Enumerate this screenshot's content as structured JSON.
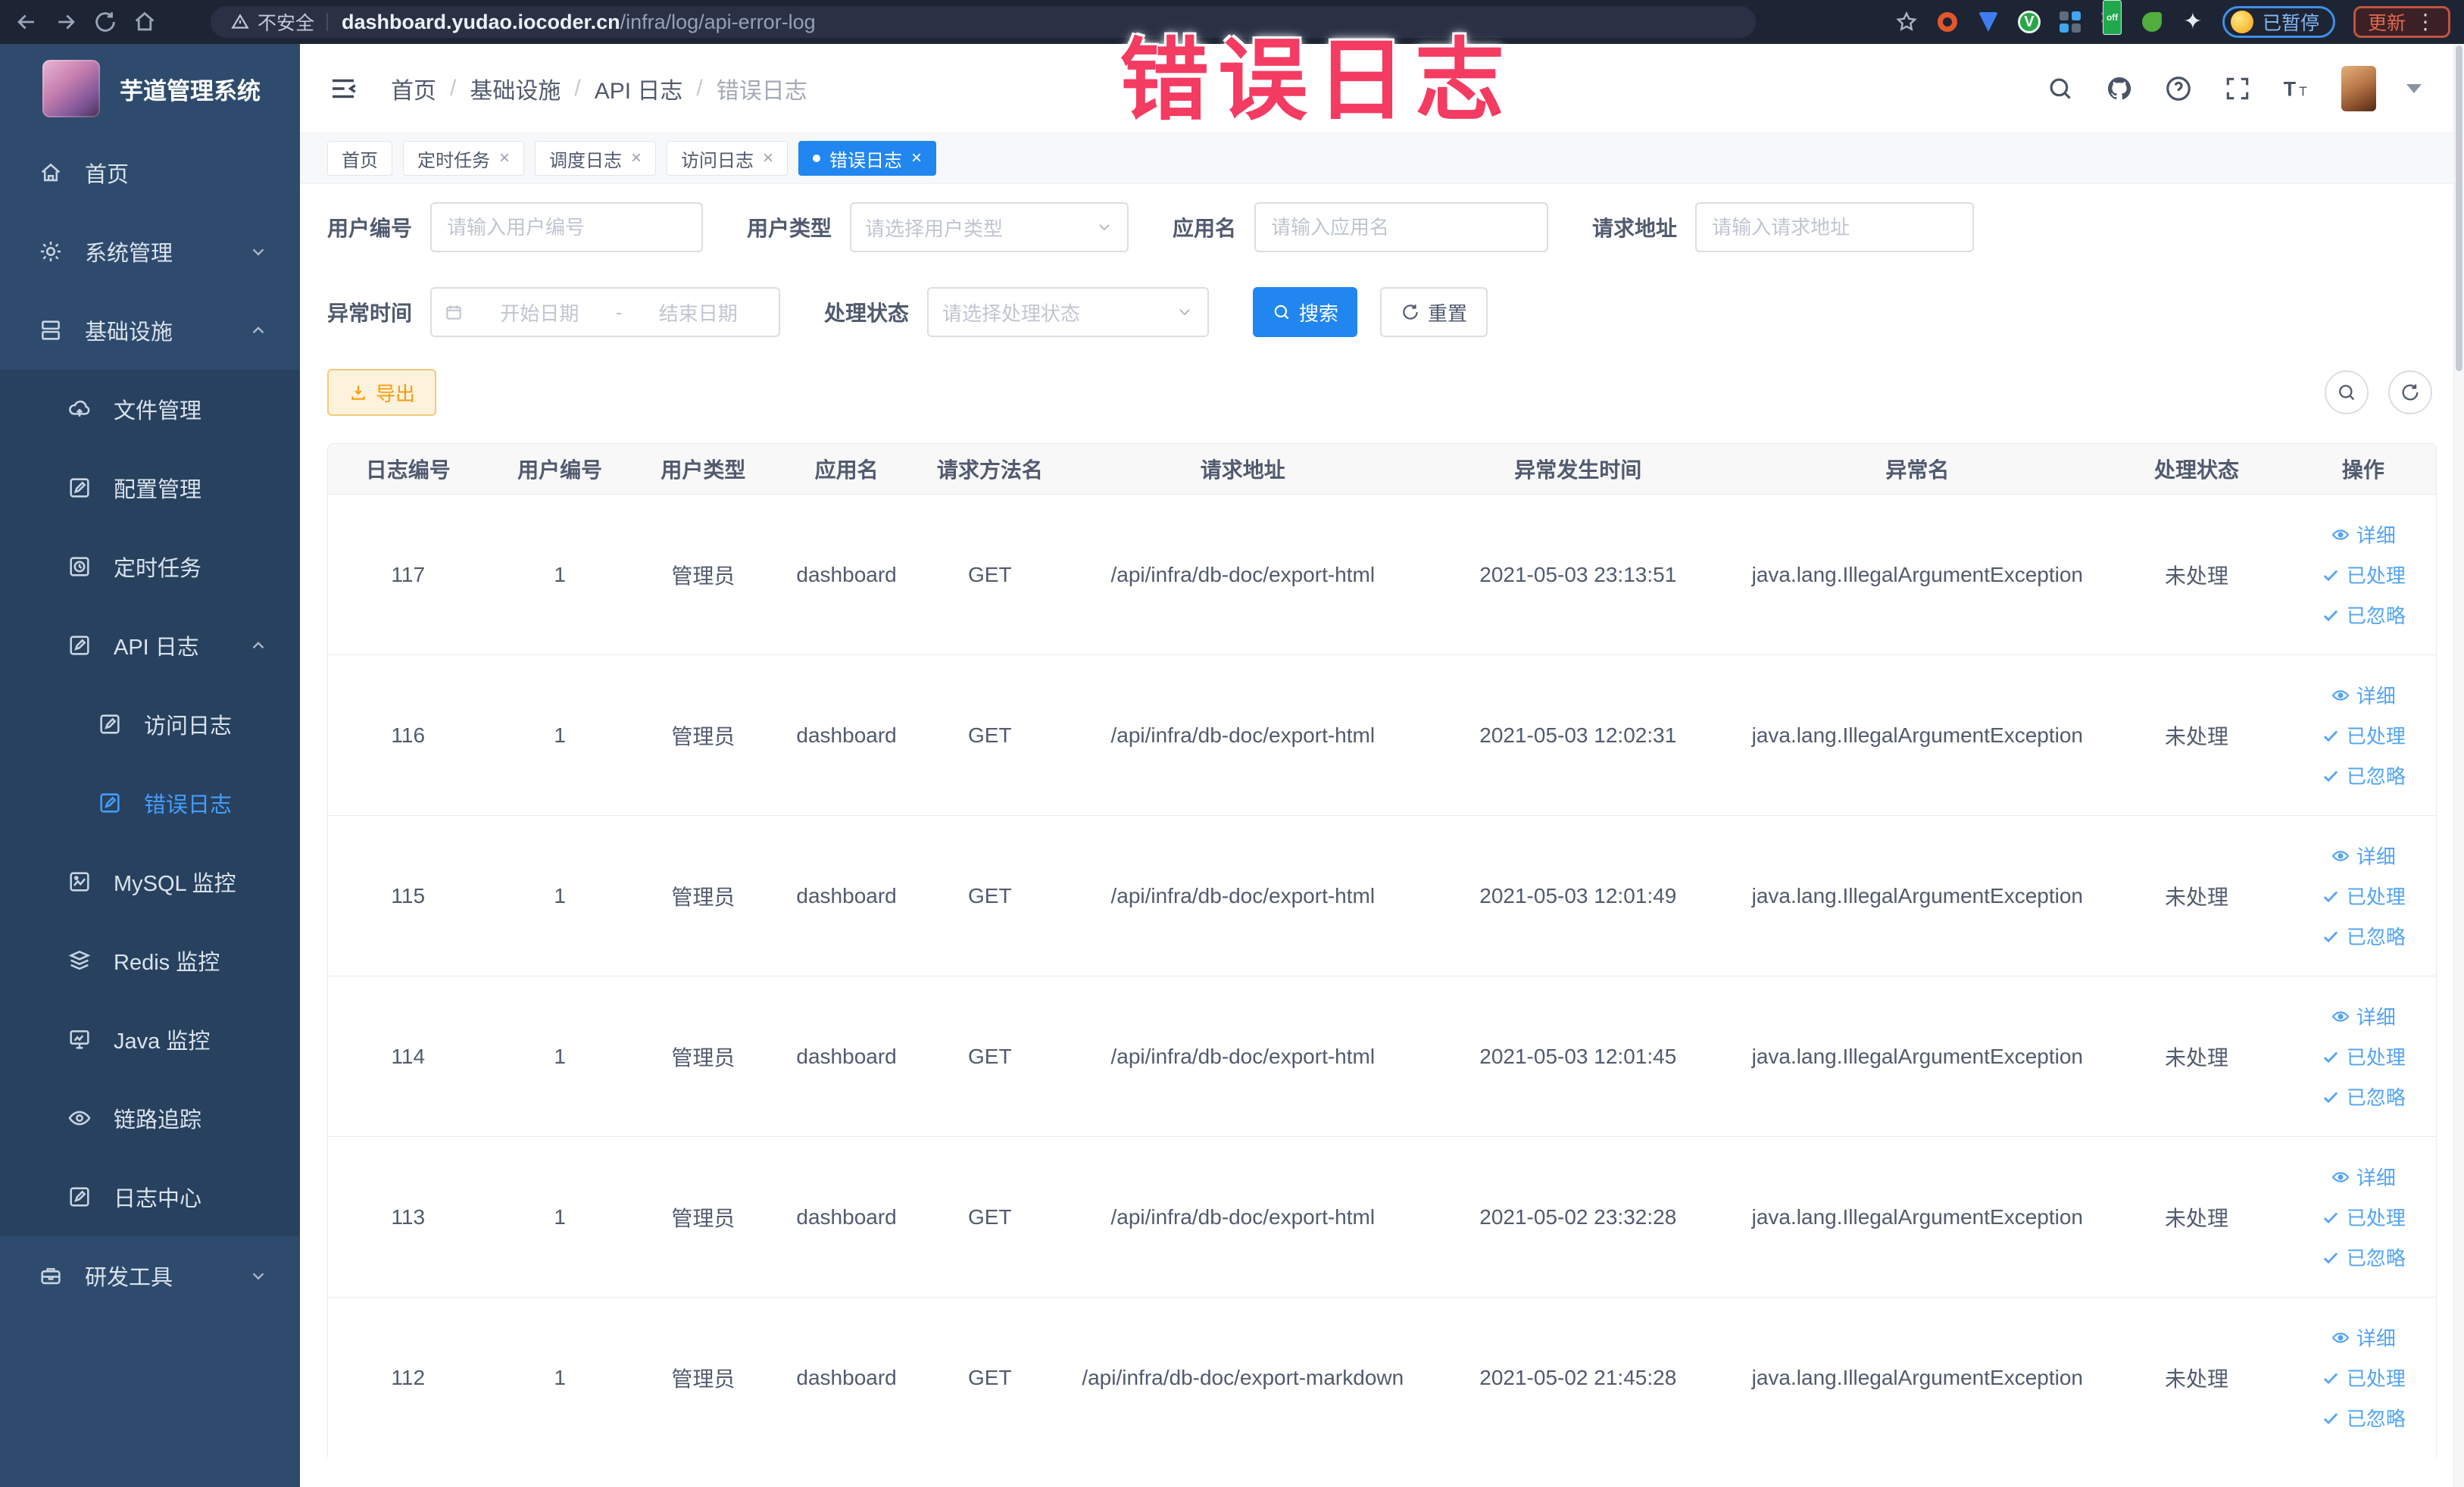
{
  "browser": {
    "security_label": "不安全",
    "url_host": "dashboard.yudao.iocoder.cn",
    "url_path": "/infra/log/api-error-log",
    "extension_off_badge": "off",
    "paused_badge": "已暂停",
    "update_button": "更新"
  },
  "annotation": {
    "text": "错误日志",
    "color": "#f43b62"
  },
  "sidebar": {
    "title": "芋道管理系统",
    "items": [
      {
        "label": "首页",
        "icon": "home-icon",
        "level": 1
      },
      {
        "label": "系统管理",
        "icon": "gear-icon",
        "level": 1,
        "chevron": "down"
      },
      {
        "label": "基础设施",
        "icon": "infra-icon",
        "level": 1,
        "chevron": "up"
      },
      {
        "label": "文件管理",
        "icon": "cloud-upload-icon",
        "level": 2,
        "sub": true
      },
      {
        "label": "配置管理",
        "icon": "edit-icon",
        "level": 2,
        "sub": true
      },
      {
        "label": "定时任务",
        "icon": "clock-icon",
        "level": 2,
        "sub": true
      },
      {
        "label": "API 日志",
        "icon": "doc-edit-icon",
        "level": 2,
        "sub": true,
        "chevron": "up"
      },
      {
        "label": "访问日志",
        "icon": "doc-edit-icon",
        "level": 3,
        "sub": true
      },
      {
        "label": "错误日志",
        "icon": "doc-edit-icon",
        "level": 3,
        "sub": true,
        "active": true
      },
      {
        "label": "MySQL 监控",
        "icon": "chart-icon",
        "level": 2,
        "sub": true
      },
      {
        "label": "Redis 监控",
        "icon": "stack-icon",
        "level": 2,
        "sub": true
      },
      {
        "label": "Java 监控",
        "icon": "monitor-icon",
        "level": 2,
        "sub": true
      },
      {
        "label": "链路追踪",
        "icon": "eye-icon",
        "level": 2,
        "sub": true
      },
      {
        "label": "日志中心",
        "icon": "doc-edit-icon",
        "level": 2,
        "sub": true
      },
      {
        "label": "研发工具",
        "icon": "toolbox-icon",
        "level": 1,
        "chevron": "down"
      }
    ]
  },
  "header": {
    "breadcrumb": [
      "首页",
      "基础设施",
      "API 日志",
      "错误日志"
    ]
  },
  "tabs": [
    {
      "label": "首页",
      "closable": false,
      "active": false
    },
    {
      "label": "定时任务",
      "closable": true,
      "active": false
    },
    {
      "label": "调度日志",
      "closable": true,
      "active": false
    },
    {
      "label": "访问日志",
      "closable": true,
      "active": false
    },
    {
      "label": "错误日志",
      "closable": true,
      "active": true
    }
  ],
  "filters": {
    "user_id": {
      "label": "用户编号",
      "placeholder": "请输入用户编号"
    },
    "user_type": {
      "label": "用户类型",
      "placeholder": "请选择用户类型"
    },
    "app_name": {
      "label": "应用名",
      "placeholder": "请输入应用名"
    },
    "request_url": {
      "label": "请求地址",
      "placeholder": "请输入请求地址"
    },
    "exception_time": {
      "label": "异常时间",
      "start_placeholder": "开始日期",
      "separator": "-",
      "end_placeholder": "结束日期"
    },
    "process_status": {
      "label": "处理状态",
      "placeholder": "请选择处理状态"
    }
  },
  "toolbar": {
    "search": "搜索",
    "reset": "重置",
    "export": "导出"
  },
  "table": {
    "columns": [
      "日志编号",
      "用户编号",
      "用户类型",
      "应用名",
      "请求方法名",
      "请求地址",
      "异常发生时间",
      "异常名",
      "处理状态",
      "操作"
    ],
    "row_actions": [
      "详细",
      "已处理",
      "已忽略"
    ],
    "rows": [
      {
        "id": "117",
        "user_id": "1",
        "user_type": "管理员",
        "app": "dashboard",
        "method": "GET",
        "url": "/api/infra/db-doc/export-html",
        "time": "2021-05-03 23:13:51",
        "exception": "java.lang.IllegalArgumentException",
        "status": "未处理"
      },
      {
        "id": "116",
        "user_id": "1",
        "user_type": "管理员",
        "app": "dashboard",
        "method": "GET",
        "url": "/api/infra/db-doc/export-html",
        "time": "2021-05-03 12:02:31",
        "exception": "java.lang.IllegalArgumentException",
        "status": "未处理"
      },
      {
        "id": "115",
        "user_id": "1",
        "user_type": "管理员",
        "app": "dashboard",
        "method": "GET",
        "url": "/api/infra/db-doc/export-html",
        "time": "2021-05-03 12:01:49",
        "exception": "java.lang.IllegalArgumentException",
        "status": "未处理"
      },
      {
        "id": "114",
        "user_id": "1",
        "user_type": "管理员",
        "app": "dashboard",
        "method": "GET",
        "url": "/api/infra/db-doc/export-html",
        "time": "2021-05-03 12:01:45",
        "exception": "java.lang.IllegalArgumentException",
        "status": "未处理"
      },
      {
        "id": "113",
        "user_id": "1",
        "user_type": "管理员",
        "app": "dashboard",
        "method": "GET",
        "url": "/api/infra/db-doc/export-html",
        "time": "2021-05-02 23:32:28",
        "exception": "java.lang.IllegalArgumentException",
        "status": "未处理"
      },
      {
        "id": "112",
        "user_id": "1",
        "user_type": "管理员",
        "app": "dashboard",
        "method": "GET",
        "url": "/api/infra/db-doc/export-markdown",
        "time": "2021-05-02 21:45:28",
        "exception": "java.lang.IllegalArgumentException",
        "status": "未处理"
      }
    ]
  },
  "colors": {
    "primary": "#2186f0",
    "link": "#53a4f5",
    "warning": "#f99b0d",
    "sidebar": "#2e4b6d",
    "annotation": "#f43b62"
  }
}
